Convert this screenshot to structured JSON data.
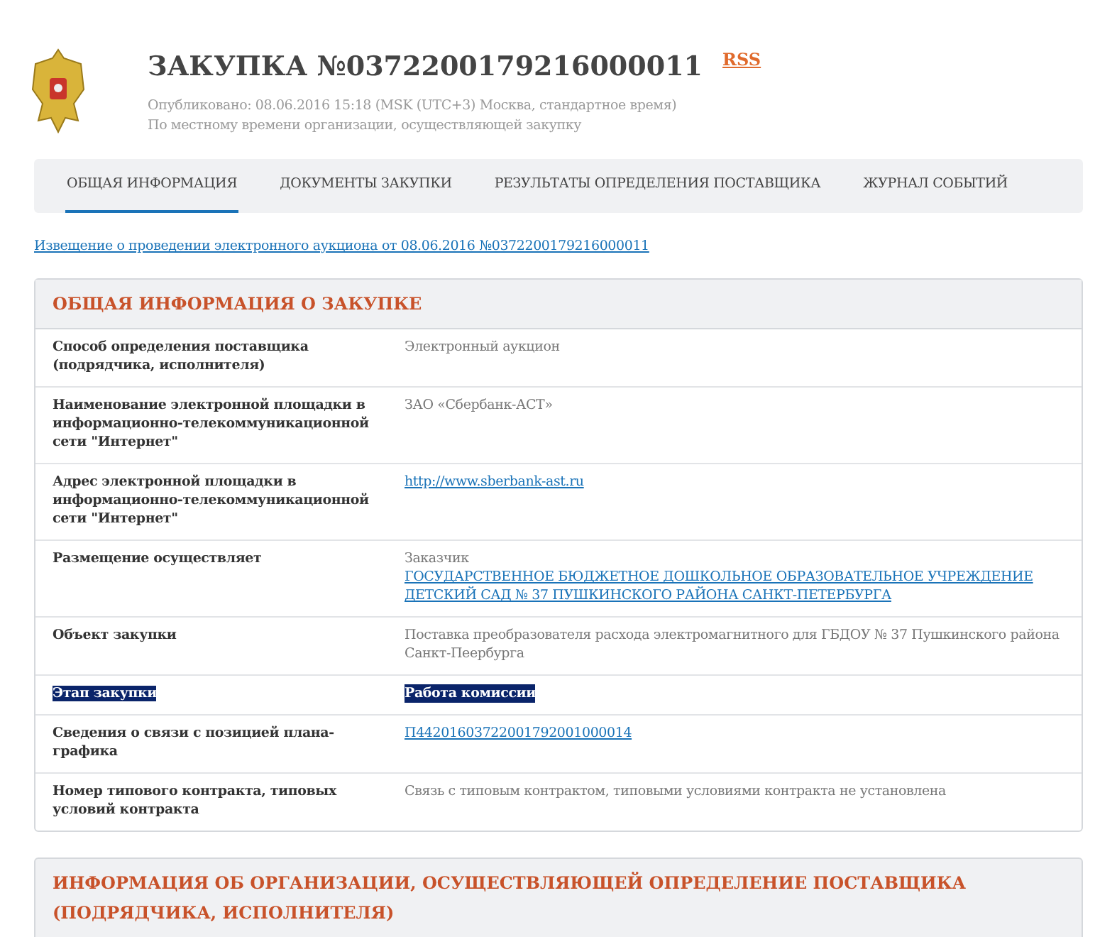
{
  "header": {
    "title": "ЗАКУПКА №0372200179216000011",
    "rss": "RSS",
    "published": "Опубликовано: 08.06.2016 15:18 (MSK (UTC+3) Москва, стандартное время)",
    "local_time_note": "По местному времени организации, осуществляющей закупку"
  },
  "tabs": [
    {
      "label": "ОБЩАЯ ИНФОРМАЦИЯ",
      "selected": true
    },
    {
      "label": "ДОКУМЕНТЫ ЗАКУПКИ",
      "selected": false
    },
    {
      "label": "РЕЗУЛЬТАТЫ ОПРЕДЕЛЕНИЯ ПОСТАВЩИКА",
      "selected": false
    },
    {
      "label": "ЖУРНАЛ СОБЫТИЙ",
      "selected": false
    }
  ],
  "notice_link": "Извещение о проведении электронного аукциона от 08.06.2016 №0372200179216000011",
  "general_section": {
    "title": "ОБЩАЯ ИНФОРМАЦИЯ О ЗАКУПКЕ",
    "rows": [
      {
        "label": "Способ определения поставщика (подрядчика, исполнителя)",
        "highlighted": false,
        "values": [
          {
            "kind": "text",
            "text": "Электронный аукцион"
          }
        ]
      },
      {
        "label": "Наименование электронной площадки в информационно-телекоммуникационной сети \"Интернет\"",
        "highlighted": false,
        "values": [
          {
            "kind": "text",
            "text": "ЗАО «Сбербанк-АСТ»"
          }
        ]
      },
      {
        "label": "Адрес электронной площадки в информационно-телекоммуникационной сети \"Интернет\"",
        "highlighted": false,
        "values": [
          {
            "kind": "link",
            "text": "http://www.sberbank-ast.ru"
          }
        ]
      },
      {
        "label": "Размещение осуществляет",
        "highlighted": false,
        "values": [
          {
            "kind": "text",
            "text": "Заказчик"
          },
          {
            "kind": "link",
            "text": "ГОСУДАРСТВЕННОЕ БЮДЖЕТНОЕ ДОШКОЛЬНОЕ ОБРАЗОВАТЕЛЬНОЕ УЧРЕЖДЕНИЕ ДЕТСКИЙ САД № 37 ПУШКИНСКОГО РАЙОНА САНКТ-ПЕТЕРБУРГА"
          }
        ]
      },
      {
        "label": "Объект закупки",
        "highlighted": false,
        "values": [
          {
            "kind": "text",
            "text": "Поставка преобразователя расхода электромагнитного для ГБДОУ № 37 Пушкинского района Санкт-Пеербурга"
          }
        ]
      },
      {
        "label": "Этап закупки",
        "highlighted": true,
        "values": [
          {
            "kind": "text",
            "text": "Работа комиссии"
          }
        ]
      },
      {
        "label": "Сведения о связи с позицией плана-графика",
        "highlighted": false,
        "values": [
          {
            "kind": "link",
            "text": "П44201603722001792001000014"
          }
        ]
      },
      {
        "label": "Номер типового контракта, типовых условий контракта",
        "highlighted": false,
        "values": [
          {
            "kind": "text",
            "text": "Связь с типовым контрактом, типовыми условиями контракта не установлена"
          }
        ]
      }
    ]
  },
  "organization_section": {
    "title": "ИНФОРМАЦИЯ ОБ ОРГАНИЗАЦИИ, ОСУЩЕСТВЛЯЮЩЕЙ ОПРЕДЕЛЕНИЕ ПОСТАВЩИКА (ПОДРЯДЧИКА, ИСПОЛНИТЕЛЯ)"
  }
}
